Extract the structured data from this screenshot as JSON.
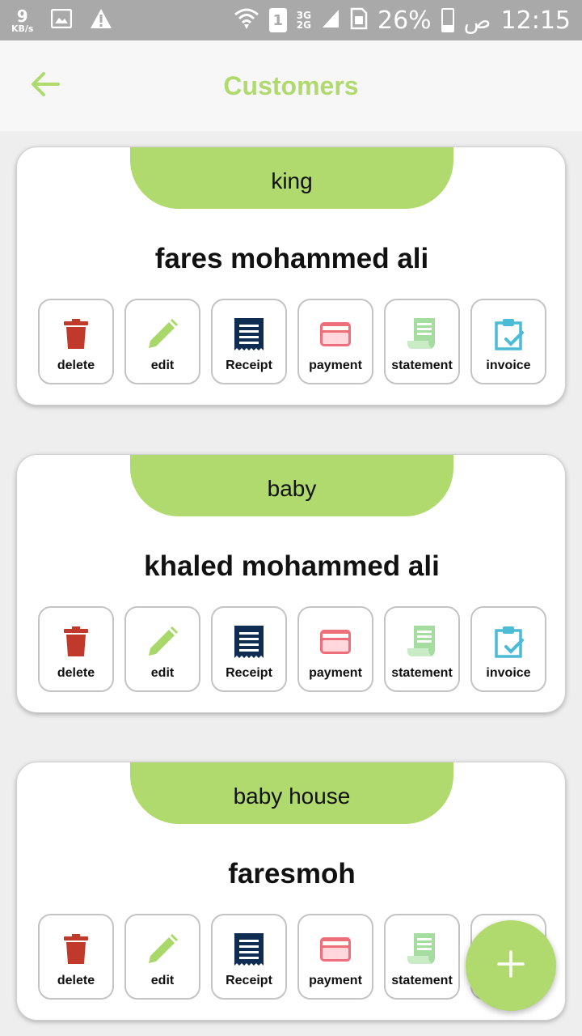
{
  "status_bar": {
    "speed_value": "9",
    "speed_unit": "KB/s",
    "sim_slot": "1",
    "net_top": "3G",
    "net_bottom": "2G",
    "battery_percent": "26%",
    "ampm": "ص",
    "time": "12:15"
  },
  "app_bar": {
    "title": "Customers",
    "back_icon": "arrow-left-icon"
  },
  "actions_labels": {
    "delete": "delete",
    "edit": "edit",
    "receipt": "Receipt",
    "payment": "payment",
    "statement": "statement",
    "invoice": "invoice"
  },
  "customers": [
    {
      "group": "king",
      "name": "fares mohammed ali"
    },
    {
      "group": "baby",
      "name": "khaled mohammed ali"
    },
    {
      "group": "baby house",
      "name": "faresmoh"
    }
  ],
  "fab": {
    "icon": "plus-icon"
  },
  "colors": {
    "accent": "#b0d96e",
    "delete": "#c0392b",
    "edit": "#a8d86a",
    "receipt": "#0f2d52",
    "payment": "#ee6e7a",
    "statement": "#a5dca0",
    "invoice": "#4bbbd6"
  }
}
